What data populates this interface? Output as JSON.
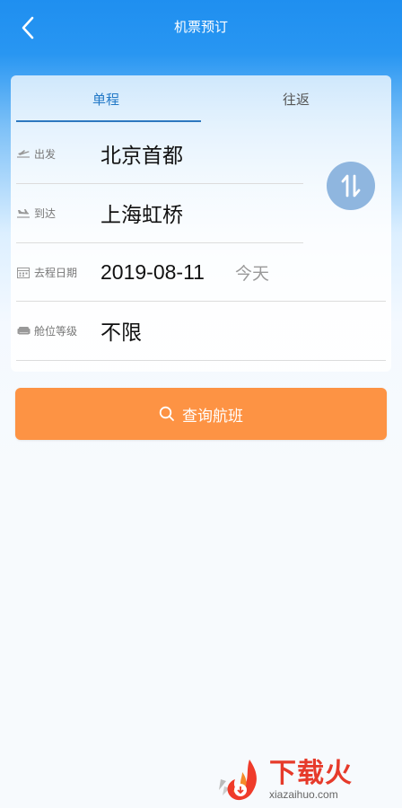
{
  "header": {
    "title": "机票预订"
  },
  "tabs": [
    {
      "label": "单程",
      "active": true
    },
    {
      "label": "往返",
      "active": false
    }
  ],
  "form": {
    "departure": {
      "label": "出发",
      "value": "北京首都"
    },
    "arrival": {
      "label": "到达",
      "value": "上海虹桥"
    },
    "date": {
      "label": "去程日期",
      "value": "2019-08-11",
      "note": "今天"
    },
    "cabin": {
      "label": "舱位等级",
      "value": "不限"
    }
  },
  "search_button": {
    "label": "查询航班"
  },
  "watermark": {
    "name": "下载火",
    "site": "xiazaihuo.com"
  },
  "colors": {
    "header": "#1f8ff0",
    "accent": "#2379c7",
    "button": "#fd9344",
    "swap": "#8fb6df"
  }
}
